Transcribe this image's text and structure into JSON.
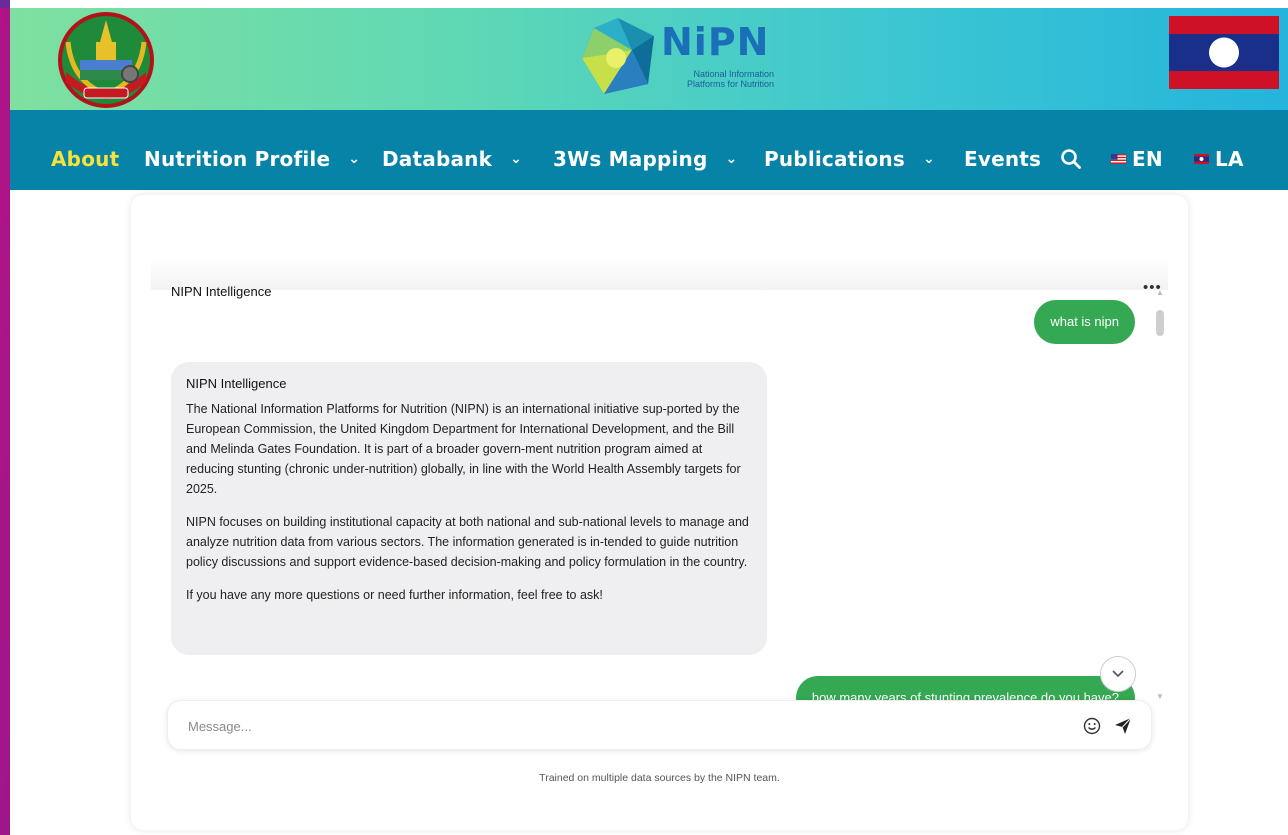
{
  "header": {
    "logo_title": "NiPN",
    "logo_subtitle_line1": "National Information",
    "logo_subtitle_line2": "Platforms for Nutrition"
  },
  "nav": {
    "items": [
      {
        "label": "About",
        "active": true
      },
      {
        "label": "Nutrition Profile",
        "dropdown": true
      },
      {
        "label": "Databank",
        "dropdown": true
      },
      {
        "label": "3Ws Mapping",
        "dropdown": true
      },
      {
        "label": "Publications",
        "dropdown": true
      },
      {
        "label": "Events"
      }
    ],
    "search_icon": "search-icon",
    "lang_en": "EN",
    "lang_la": "LA",
    "active_color": "#f5e23c",
    "bar_color": "#0783a8"
  },
  "chat": {
    "title": "NIPN Intelligence",
    "menu_icon": "more-dots-icon",
    "messages": [
      {
        "role": "user",
        "text": "what is nipn"
      },
      {
        "role": "assistant",
        "name": "NIPN Intelligence",
        "paragraphs": [
          "The National Information Platforms for Nutrition (NIPN) is an international initiative sup-ported by the European Commission, the United Kingdom Department for International Development, and the Bill and Melinda Gates Foundation. It is part of a broader govern-ment nutrition program aimed at reducing stunting (chronic under-nutrition) globally, in line with the World Health Assembly targets for 2025.",
          "NIPN focuses on building institutional capacity at both national and sub-national levels to manage and analyze nutrition data from various sectors. The information generated is in-tended to guide nutrition policy discussions and support evidence-based decision-making and policy formulation in the country.",
          "If you have any more questions or need further information, feel free to ask!"
        ]
      },
      {
        "role": "user",
        "text": "how many years of stunting prevalence do you have?"
      }
    ],
    "input_placeholder": "Message...",
    "input_value": "",
    "footer": "Trained on multiple data sources by the NIPN team.",
    "user_bubble_color": "#34a853",
    "bot_bubble_color": "#efeff1"
  }
}
